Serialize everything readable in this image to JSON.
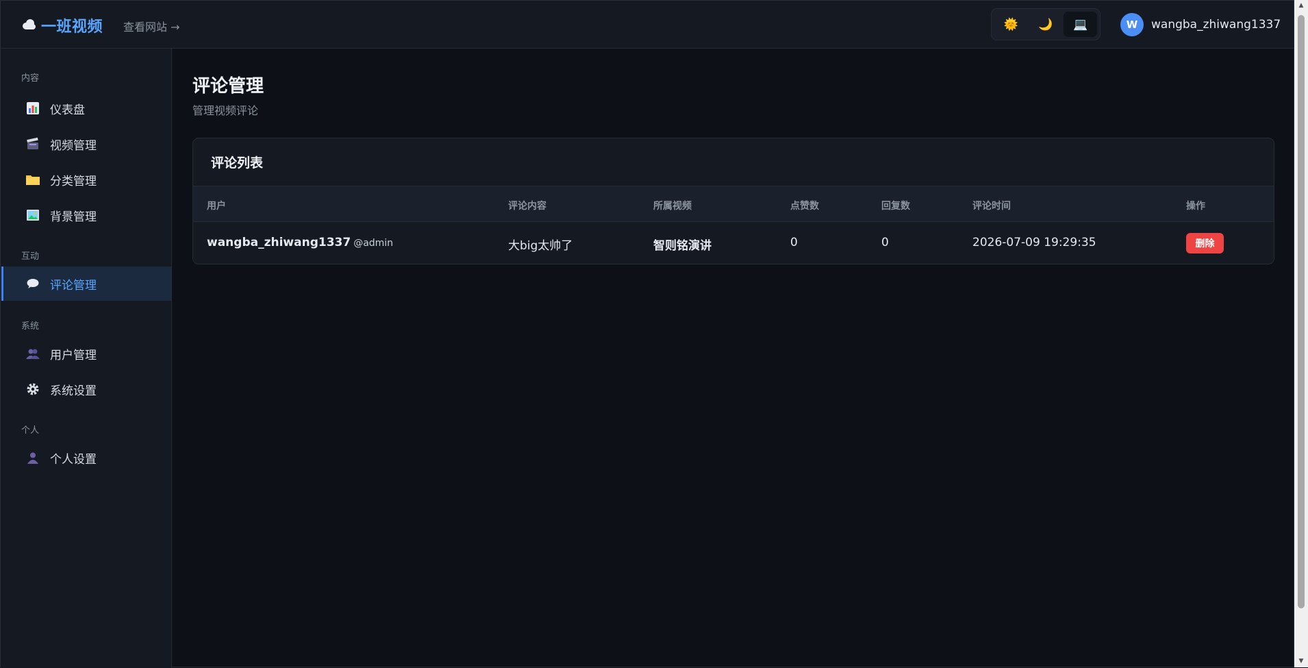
{
  "header": {
    "brand_name": "一班视频",
    "view_site": "查看网站 →",
    "theme_options": [
      {
        "name": "light",
        "glyph": "🌞"
      },
      {
        "name": "dark",
        "glyph": "🌙"
      },
      {
        "name": "system",
        "glyph": "💻"
      }
    ],
    "user": {
      "avatar_letter": "W",
      "name": "wangba_zhiwang1337"
    }
  },
  "sidebar": {
    "sections": {
      "content": "内容",
      "interaction": "互动",
      "system": "系统",
      "personal": "个人"
    },
    "items": {
      "dashboard": "仪表盘",
      "videos": "视频管理",
      "categories": "分类管理",
      "backgrounds": "背景管理",
      "comments": "评论管理",
      "users": "用户管理",
      "settings": "系统设置",
      "profile": "个人设置"
    }
  },
  "main": {
    "title": "评论管理",
    "subtitle": "管理视频评论",
    "card_title": "评论列表",
    "columns": {
      "user": "用户",
      "content": "评论内容",
      "video": "所属视频",
      "likes": "点赞数",
      "replies": "回复数",
      "time": "评论时间",
      "actions": "操作"
    },
    "rows": [
      {
        "user": "wangba_zhiwang1337",
        "role": "@admin",
        "content": "大big太帅了",
        "video": "智则铭演讲",
        "likes": "0",
        "replies": "0",
        "time": "2026-07-09 19:29:35",
        "action_label": "删除"
      }
    ]
  },
  "colors": {
    "accent": "#58a6ff",
    "danger": "#ef4444",
    "background": "#0d1016",
    "panel": "#141922"
  }
}
